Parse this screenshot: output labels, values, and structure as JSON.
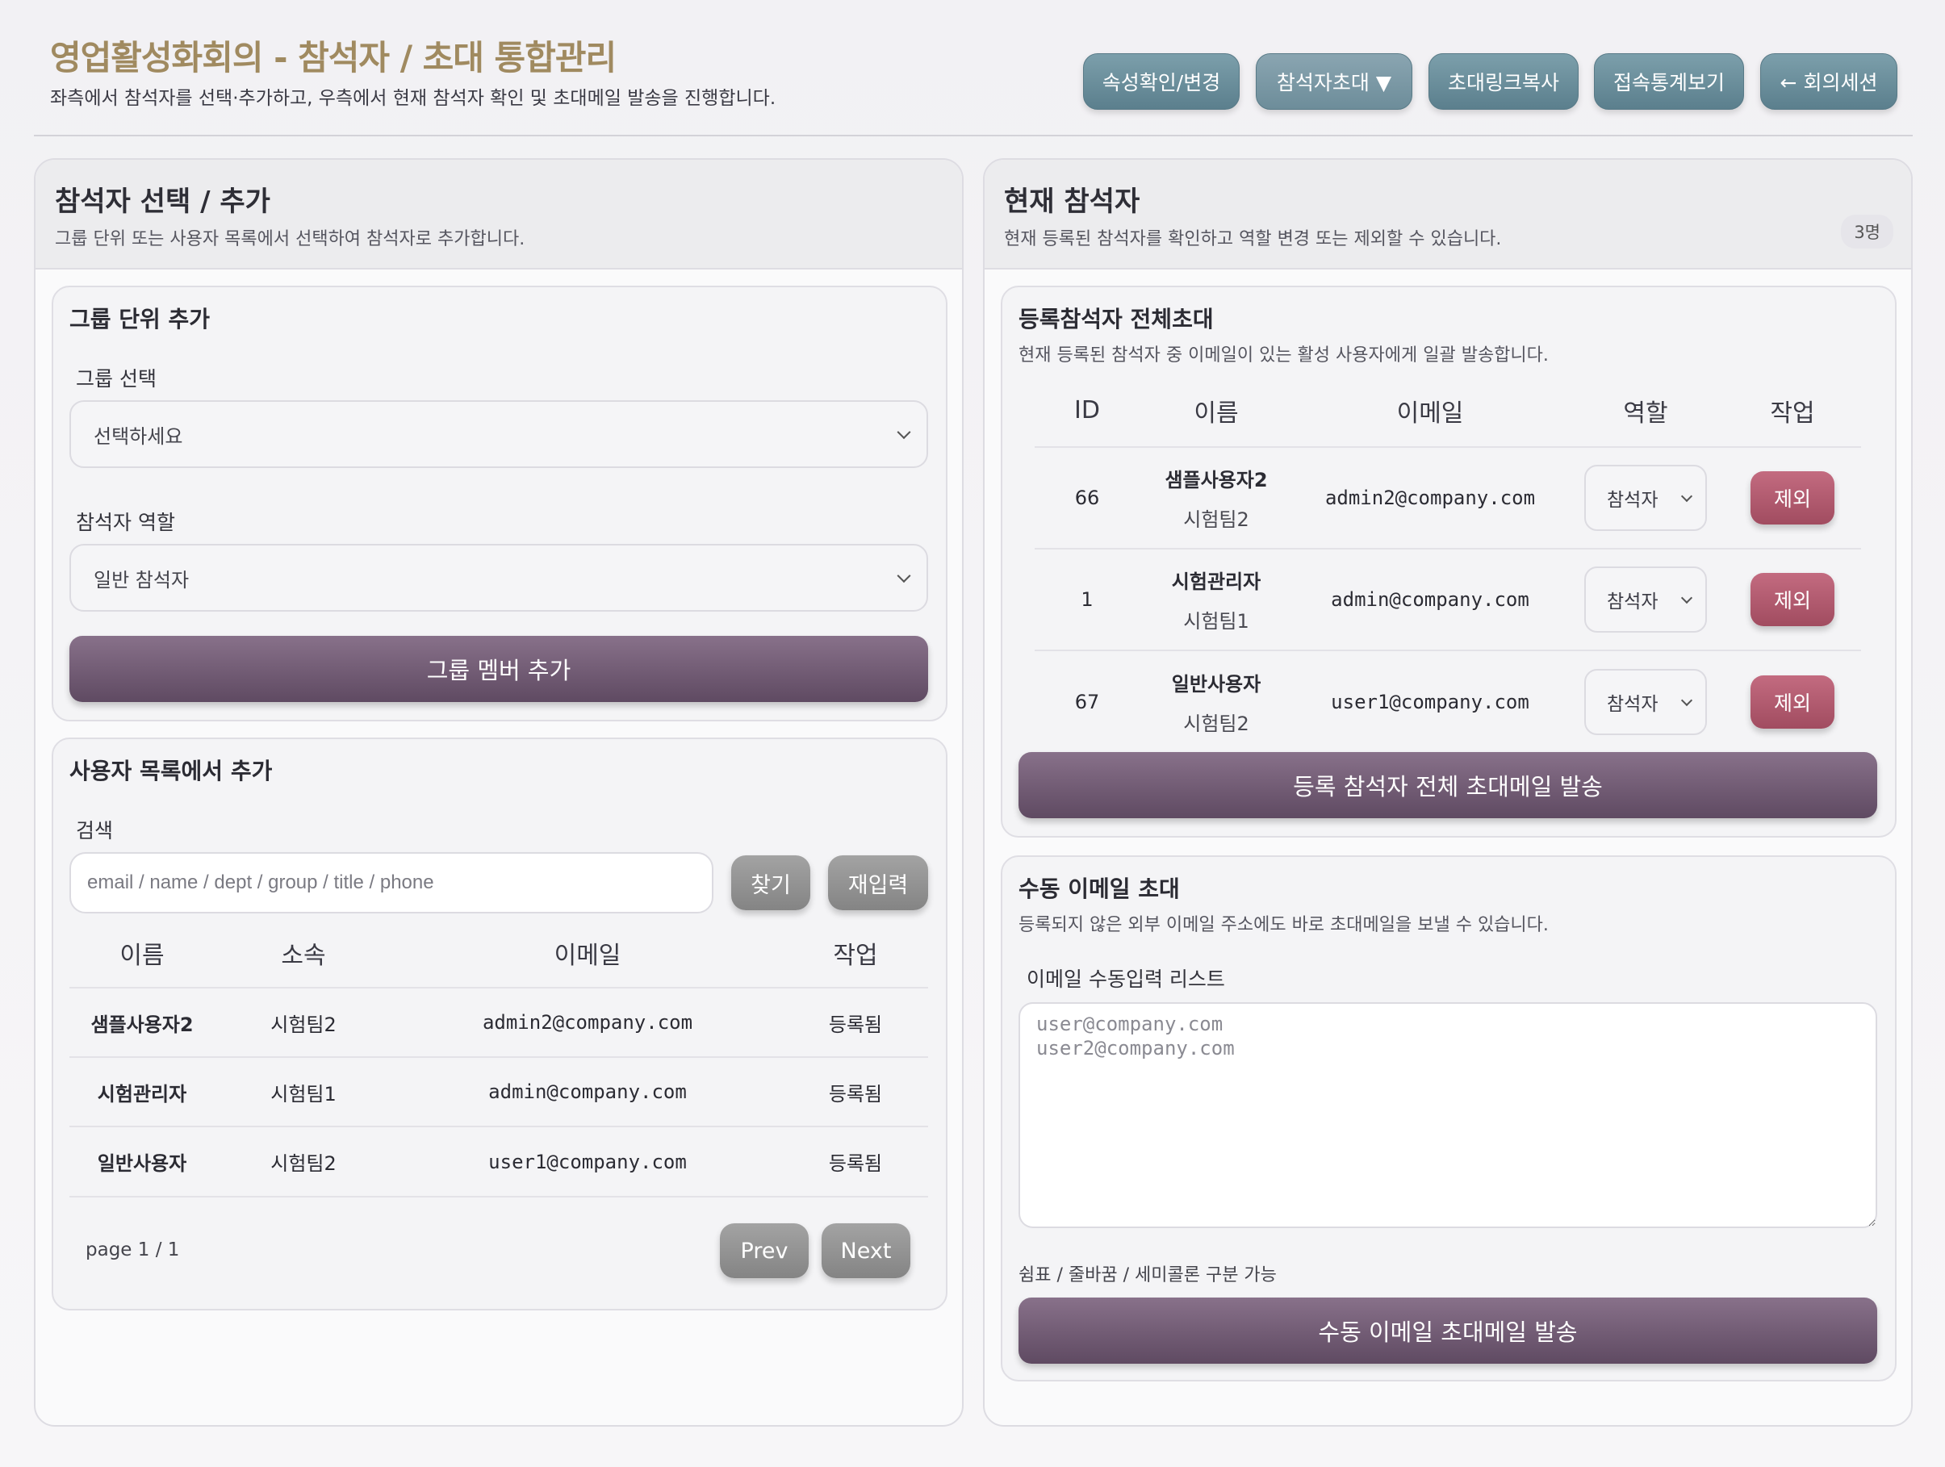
{
  "header": {
    "title": "영업활성화회의 - 참석자 / 초대 통합관리",
    "subtitle": "좌측에서 참석자를 선택·추가하고, 우측에서 현재 참석자 확인 및 초대메일 발송을 진행합니다.",
    "buttons": {
      "attributes": "속성확인/변경",
      "invite": "참석자초대 ▼",
      "copy_link": "초대링크복사",
      "stats": "접속통계보기",
      "back": "← 회의세션"
    }
  },
  "left_panel": {
    "title": "참석자 선택 / 추가",
    "desc": "그룹 단위 또는 사용자 목록에서 선택하여 참석자로 추가합니다.",
    "group_card": {
      "title": "그룹 단위 추가",
      "group_label": "그룹 선택",
      "group_value": "선택하세요",
      "role_label": "참석자 역할",
      "role_value": "일반 참석자",
      "add_button": "그룹 멤버 추가"
    },
    "user_card": {
      "title": "사용자 목록에서 추가",
      "search_label": "검색",
      "search_placeholder": "email / name / dept / group / title / phone",
      "find_button": "찾기",
      "reset_button": "재입력",
      "columns": [
        "이름",
        "소속",
        "이메일",
        "작업"
      ],
      "rows": [
        {
          "name": "샘플사용자2",
          "dept": "시험팀2",
          "email": "admin2@company.com",
          "status": "등록됨"
        },
        {
          "name": "시험관리자",
          "dept": "시험팀1",
          "email": "admin@company.com",
          "status": "등록됨"
        },
        {
          "name": "일반사용자",
          "dept": "시험팀2",
          "email": "user1@company.com",
          "status": "등록됨"
        }
      ],
      "page_info": "page 1 / 1",
      "prev": "Prev",
      "next": "Next"
    }
  },
  "right_panel": {
    "title": "현재 참석자",
    "desc": "현재 등록된 참석자를 확인하고 역할 변경 또는 제외할 수 있습니다.",
    "count": "3명",
    "invite_all_card": {
      "title": "등록참석자 전체초대",
      "desc": "현재 등록된 참석자 중 이메일이 있는 활성 사용자에게 일괄 발송합니다.",
      "columns": [
        "ID",
        "이름",
        "이메일",
        "역할",
        "작업"
      ],
      "rows": [
        {
          "id": "66",
          "name": "샘플사용자2",
          "dept": "시험팀2",
          "email": "admin2@company.com",
          "role": "참석자",
          "action": "제외"
        },
        {
          "id": "1",
          "name": "시험관리자",
          "dept": "시험팀1",
          "email": "admin@company.com",
          "role": "참석자",
          "action": "제외"
        },
        {
          "id": "67",
          "name": "일반사용자",
          "dept": "시험팀2",
          "email": "user1@company.com",
          "role": "참석자",
          "action": "제외"
        }
      ],
      "send_button": "등록 참석자 전체 초대메일 발송"
    },
    "manual_card": {
      "title": "수동 이메일 초대",
      "desc": "등록되지 않은 외부 이메일 주소에도 바로 초대메일을 보낼 수 있습니다.",
      "list_label": "이메일 수동입력 리스트",
      "placeholder": "user@company.com\nuser2@company.com",
      "hint": "쉼표 / 줄바꿈 / 세미콜론 구분 가능",
      "send_button": "수동 이메일 초대메일 발송"
    }
  },
  "colors": {
    "title": "#a08a60",
    "header_button": "#6b8e9b",
    "primary_button": "#6f5a72",
    "danger_button": "#b25a6f",
    "gray_button": "#959595"
  }
}
